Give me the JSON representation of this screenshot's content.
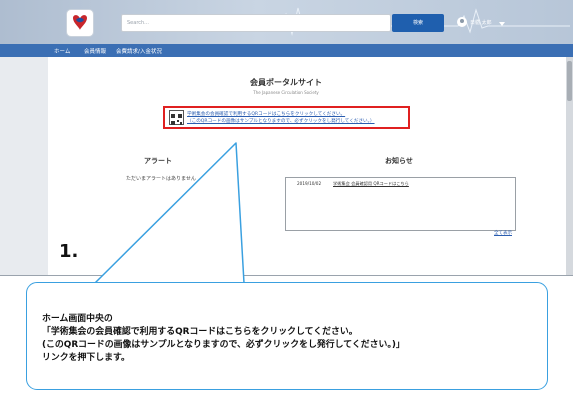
{
  "header": {
    "search_placeholder": "Search...",
    "search_button": "検索",
    "user_name": "日循 太郎"
  },
  "nav": {
    "items": [
      "ホーム",
      "会員情報",
      "会費請求/入金状況"
    ]
  },
  "portal": {
    "title": "会員ポータルサイト",
    "subtitle": "The Japanese Circulation Society",
    "qr_link_line1": "学術集会の会員確認で利用するQRコードはこちらをクリックしてください。",
    "qr_link_line2": "（このQRコードの画像はサンプルとなりますので、必ずクリックをし発行してください。）"
  },
  "alert": {
    "title": "アラート",
    "empty_text": "ただいまアラートはありません"
  },
  "notice": {
    "title": "お知らせ",
    "items": [
      {
        "date": "2019/10/02",
        "text": "学術集会 会員確認用 QRコードはこちら"
      }
    ],
    "view_all": "全て表示"
  },
  "step_label": "1.",
  "callout": {
    "lines": [
      "ホーム画面中央の",
      "「学術集会の会員確認で利用するQRコードはこちらをクリックしてください。",
      "(このQRコードの画像はサンプルとなりますので、必ずクリックをし発行してください。)」",
      "リンクを押下します。"
    ]
  },
  "colors": {
    "nav_bar": "#3b6fb4",
    "search_button": "#1f5fae",
    "highlight_box": "#e02020",
    "callout_border": "#3aa0e0",
    "link": "#2a5db0"
  }
}
